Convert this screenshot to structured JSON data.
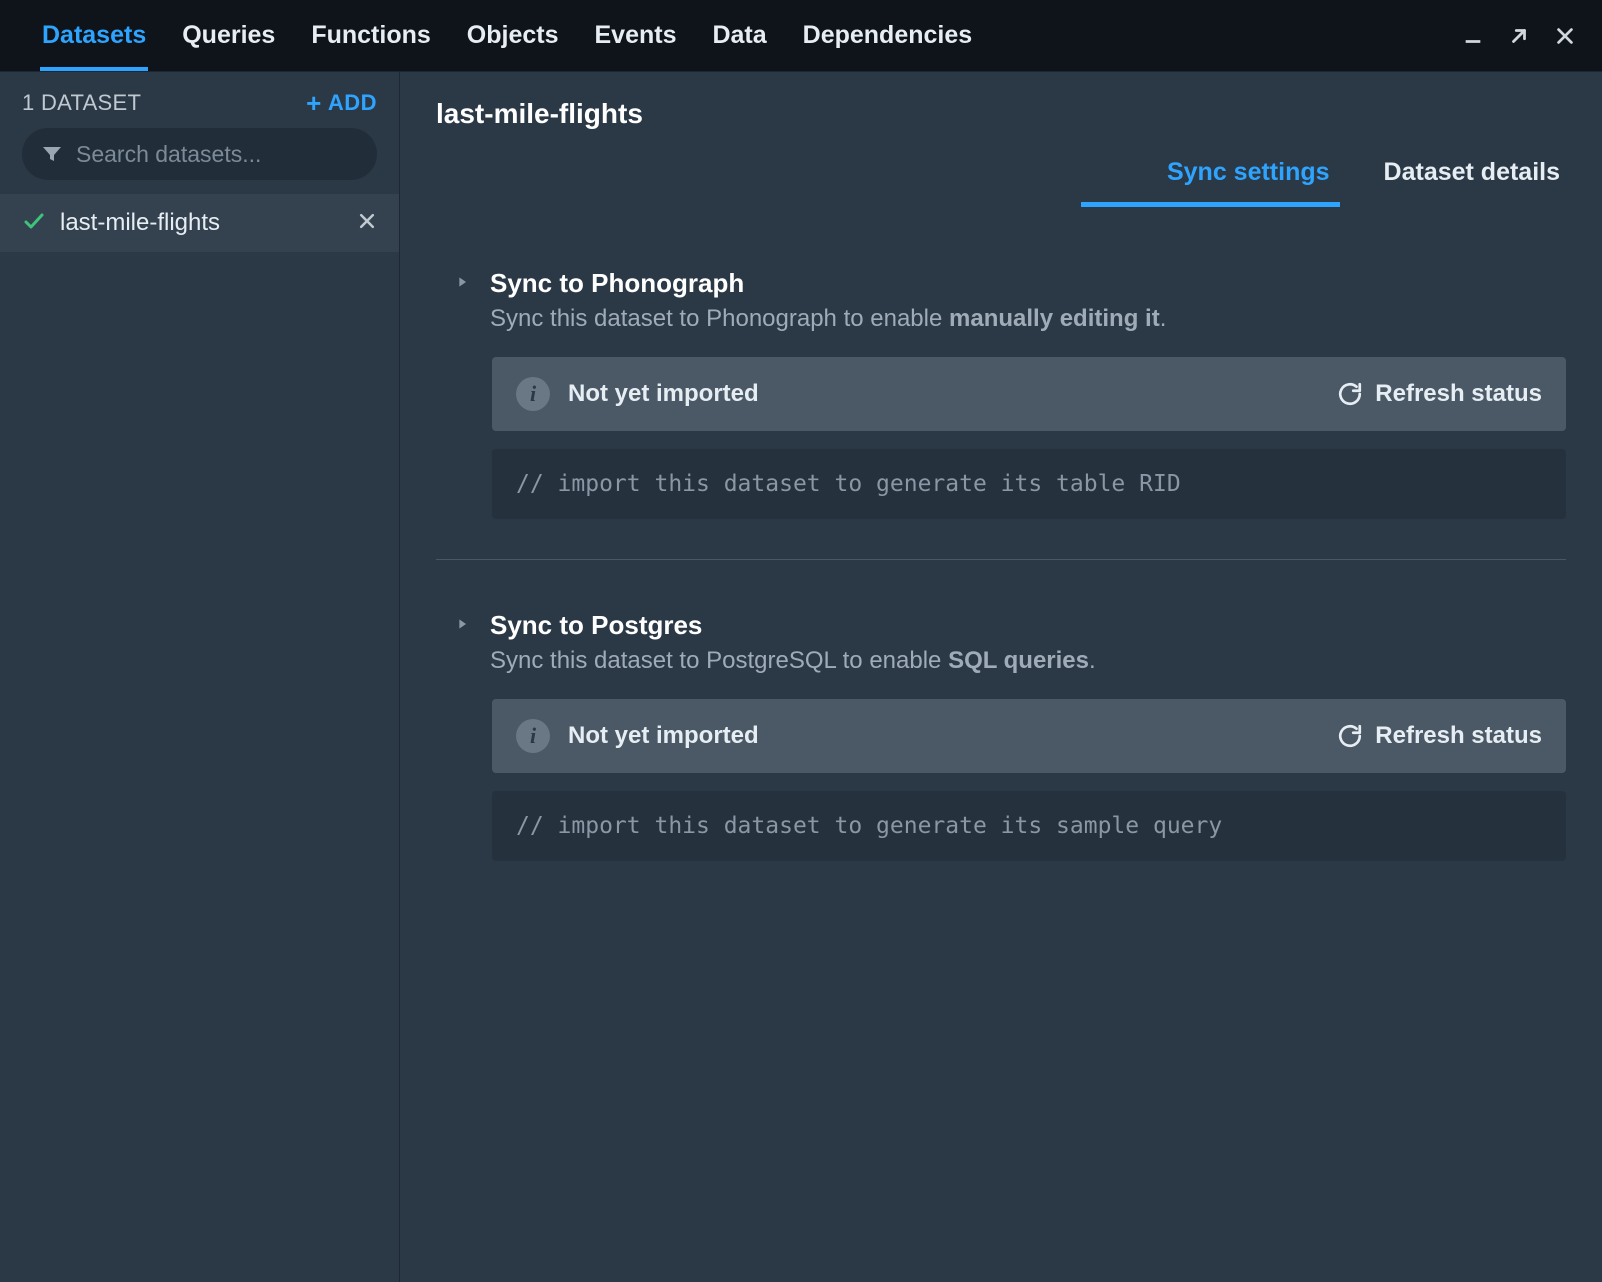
{
  "topbar": {
    "tabs": [
      {
        "label": "Datasets",
        "active": true
      },
      {
        "label": "Queries"
      },
      {
        "label": "Functions"
      },
      {
        "label": "Objects"
      },
      {
        "label": "Events"
      },
      {
        "label": "Data"
      },
      {
        "label": "Dependencies"
      }
    ]
  },
  "sidebar": {
    "count_label": "1 DATASET",
    "add_label": "ADD",
    "search_placeholder": "Search datasets...",
    "items": [
      {
        "name": "last-mile-flights"
      }
    ]
  },
  "main": {
    "title": "last-mile-flights",
    "tabs": [
      {
        "label": "Sync settings",
        "active": true
      },
      {
        "label": "Dataset details"
      }
    ],
    "sections": [
      {
        "title": "Sync to Phonograph",
        "desc_prefix": "Sync this dataset to Phonograph to enable ",
        "desc_bold": "manually editing it",
        "desc_suffix": ".",
        "status": "Not yet imported",
        "refresh_label": "Refresh status",
        "code": "// import this dataset to generate its table RID"
      },
      {
        "title": "Sync to Postgres",
        "desc_prefix": "Sync this dataset to PostgreSQL to enable ",
        "desc_bold": "SQL queries",
        "desc_suffix": ".",
        "status": "Not yet imported",
        "refresh_label": "Refresh status",
        "code": "// import this dataset to generate its sample query"
      }
    ]
  }
}
